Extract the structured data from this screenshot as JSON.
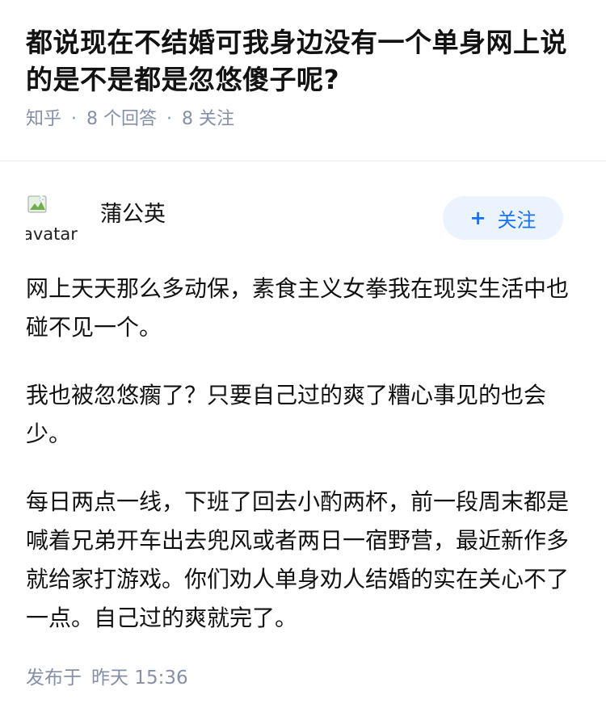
{
  "question": {
    "title": "都说现在不结婚可我身边没有一个单身网上说的是不是都是忽悠傻子呢?",
    "source": "知乎",
    "answer_count": "8 个回答",
    "follower_count": "8 关注",
    "separator": "·"
  },
  "answer": {
    "author": {
      "name": "蒲公英",
      "avatar_alt": "avatar",
      "follow_label": "关注",
      "follow_icon": "plus-icon"
    },
    "paragraphs": [
      "网上天天那么多动保，素食主义女拳我在现实生活中也碰不见一个。",
      "我也被忽悠瘸了？只要自己过的爽了糟心事见的也会少。",
      "每日两点一线，下班了回去小酌两杯，前一段周末都是喊着兄弟开车出去兜风或者两日一宿野营，最近新作多就给家打游戏。你们劝人单身劝人结婚的实在关心不了一点。自己过的爽就完了。"
    ],
    "published_label": "发布于",
    "published_time": "昨天 15:36"
  },
  "colors": {
    "text": "#121212",
    "meta": "#8590a6",
    "accent": "#1772f6",
    "follow_bg": "#ebf3fe",
    "divider": "#ebebeb"
  }
}
